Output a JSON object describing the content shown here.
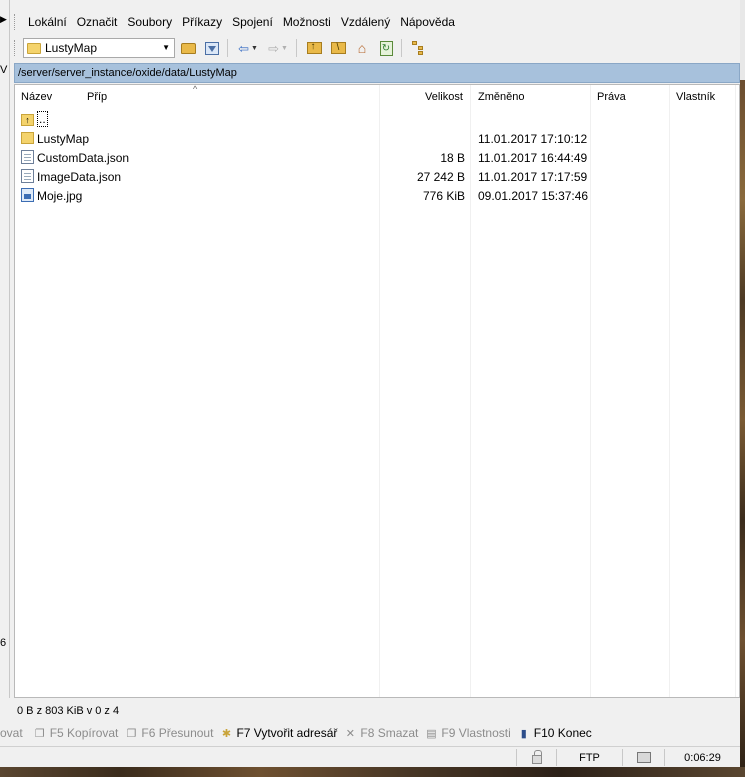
{
  "left_panel_fragments": [
    "V",
    "6",
    "ovat"
  ],
  "menubar": {
    "items": [
      "Lokální",
      "Označit",
      "Soubory",
      "Příkazy",
      "Spojení",
      "Možnosti",
      "Vzdálený",
      "Nápověda"
    ]
  },
  "toolbar": {
    "path_combo_value": "LustyMap"
  },
  "path_bar": {
    "path": "/server/server_instance/oxide/data/LustyMap"
  },
  "file_list": {
    "columns": [
      "Název",
      "Příp",
      "Velikost",
      "Změněno",
      "Práva",
      "Vlastník"
    ],
    "rows": [
      {
        "name": "..",
        "size": "",
        "modified": "",
        "type": "parent"
      },
      {
        "name": "LustyMap",
        "size": "",
        "modified": "11.01.2017 17:10:12",
        "type": "folder"
      },
      {
        "name": "CustomData.json",
        "size": "18 B",
        "modified": "11.01.2017 16:44:49",
        "type": "document"
      },
      {
        "name": "ImageData.json",
        "size": "27 242 B",
        "modified": "11.01.2017 17:17:59",
        "type": "document"
      },
      {
        "name": "Moje.jpg",
        "size": "776 KiB",
        "modified": "09.01.2017 15:37:46",
        "type": "image"
      }
    ]
  },
  "status": {
    "selection": "0 B z 803 KiB v 0 z 4"
  },
  "function_keys": [
    {
      "label": "F5 Kopírovat",
      "enabled": false
    },
    {
      "label": "F6 Přesunout",
      "enabled": false
    },
    {
      "label": "F7 Vytvořit adresář",
      "enabled": true
    },
    {
      "label": "F8 Smazat",
      "enabled": false
    },
    {
      "label": "F9 Vlastnosti",
      "enabled": false
    },
    {
      "label": "F10 Konec",
      "enabled": true
    }
  ],
  "statusbar": {
    "protocol": "FTP",
    "elapsed": "0:06:29"
  }
}
